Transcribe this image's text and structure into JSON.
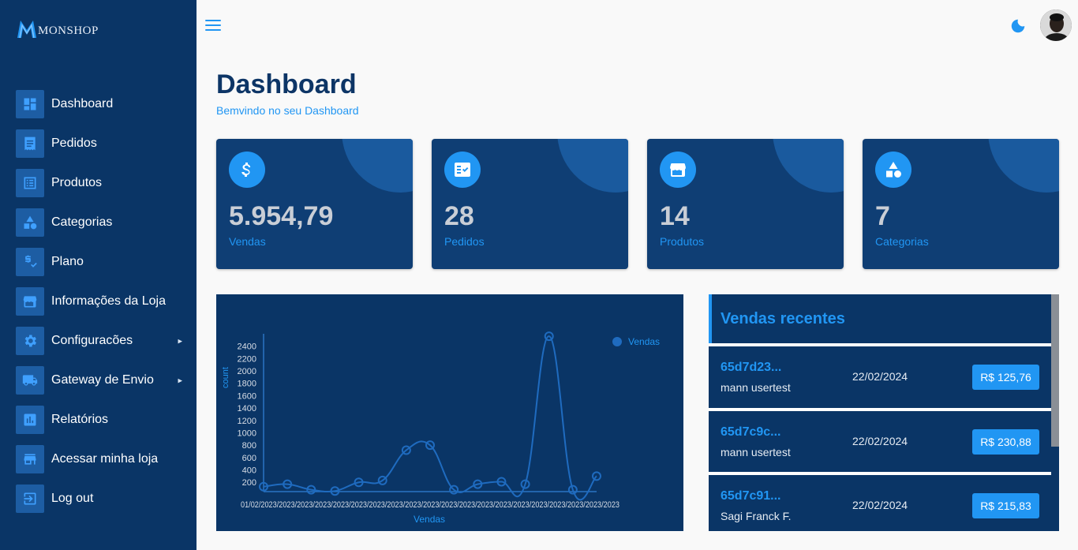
{
  "app": {
    "brand": "MONSHOP"
  },
  "sidebar": {
    "items": [
      {
        "label": "Dashboard",
        "icon": "dashboard-icon"
      },
      {
        "label": "Pedidos",
        "icon": "receipt-icon"
      },
      {
        "label": "Produtos",
        "icon": "list-icon"
      },
      {
        "label": "Categorias",
        "icon": "category-icon"
      },
      {
        "label": "Plano",
        "icon": "price-check-icon"
      },
      {
        "label": "Informações da Loja",
        "icon": "storefront-icon"
      },
      {
        "label": "Configuracões",
        "icon": "gear-icon",
        "submenu": true
      },
      {
        "label": "Gateway de Envio",
        "icon": "truck-icon",
        "submenu": true
      },
      {
        "label": "Relatórios",
        "icon": "chart-icon"
      },
      {
        "label": "Acessar minha loja",
        "icon": "store-icon"
      },
      {
        "label": "Log out",
        "icon": "logout-icon"
      }
    ]
  },
  "header": {
    "menu_icon": "hamburger-icon",
    "theme_icon": "moon-icon"
  },
  "main": {
    "title": "Dashboard",
    "subtitle": "Bemvindo no seu Dashboard"
  },
  "stats": [
    {
      "value": "5.954,79",
      "label": "Vendas",
      "icon": "dollar-icon"
    },
    {
      "value": "28",
      "label": "Pedidos",
      "icon": "checklist-icon"
    },
    {
      "value": "14",
      "label": "Produtos",
      "icon": "storefront-icon"
    },
    {
      "value": "7",
      "label": "Categorias",
      "icon": "category-icon"
    }
  ],
  "recent_sales": {
    "title": "Vendas recentes",
    "items": [
      {
        "id": "65d7d23...",
        "customer": "mann usertest",
        "date": "22/02/2024",
        "amount": "R$ 125,76"
      },
      {
        "id": "65d7c9c...",
        "customer": "mann usertest",
        "date": "22/02/2024",
        "amount": "R$ 230,88"
      },
      {
        "id": "65d7c91...",
        "customer": "Sagi Franck F.",
        "date": "22/02/2024",
        "amount": "R$ 215,83"
      }
    ]
  },
  "colors": {
    "sidebar_bg": "#0a3566",
    "accent": "#2196f3",
    "card_bg": "#0f3e74"
  },
  "chart_data": {
    "type": "line",
    "xlabel": "Vendas",
    "ylabel": "count",
    "legend": "Vendas",
    "legend_position": "top-right",
    "y_ticks": [
      200,
      400,
      600,
      800,
      1000,
      1200,
      1400,
      1600,
      1800,
      2000,
      2200,
      2400
    ],
    "ylim": [
      50,
      2600
    ],
    "tick_label_overlap": "01/02/2023/2023/2023/2023/2023/2023/2023/2023/2023/2023/2023/2023/2023/2023/2023/2023/2023/2023/2023/2023",
    "series": [
      {
        "name": "Vendas",
        "values": [
          130,
          170,
          80,
          60,
          200,
          230,
          720,
          800,
          80,
          170,
          210,
          170,
          2560,
          80,
          300
        ]
      }
    ]
  }
}
